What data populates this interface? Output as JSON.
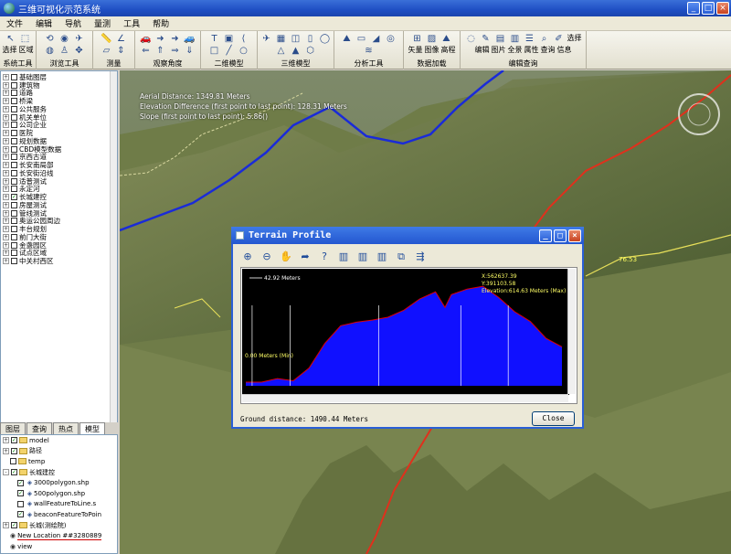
{
  "window": {
    "title": "三维可视化示范系统",
    "min": "_",
    "max": "□",
    "close": "×"
  },
  "menu": [
    "文件",
    "编辑",
    "导航",
    "量测",
    "工具",
    "帮助"
  ],
  "toolbar": {
    "groups": [
      {
        "label": "系统工具",
        "items": [
          "选择",
          "区域"
        ]
      },
      {
        "label": "浏览工具",
        "items": []
      },
      {
        "label": "测量",
        "items": []
      },
      {
        "label": "观察角度",
        "items": []
      },
      {
        "label": "二维模型",
        "items": []
      },
      {
        "label": "三维模型",
        "items": []
      },
      {
        "label": "分析工具",
        "items": []
      },
      {
        "label": "数据加载",
        "items": [
          "矢量",
          "图像",
          "高程"
        ]
      },
      {
        "label": "编辑查询",
        "items": [
          "选择",
          "编辑",
          "图片",
          "全景",
          "属性",
          "查询",
          "信息"
        ]
      }
    ]
  },
  "tree": [
    "基础图层",
    "建筑物",
    "道路",
    "桥梁",
    "公共服务",
    "机关单位",
    "公司企业",
    "医院",
    "规划数据",
    "CBD模型数据",
    "京西古道",
    "长安南局部",
    "长安街沿线",
    "适普测试",
    "永定河",
    "长城建控",
    "房屋测试",
    "管线测试",
    "奥运公园周边",
    "丰台规划",
    "前门大街",
    "金盏园区",
    "试点区域",
    "中关村西区"
  ],
  "tree_checked": [
    15
  ],
  "tabs": [
    "图层",
    "查询",
    "热点",
    "模型"
  ],
  "layers": [
    {
      "name": "model",
      "indent": 0,
      "exp": "+",
      "chk": true,
      "folder": true
    },
    {
      "name": "路径",
      "indent": 0,
      "exp": "+",
      "chk": true,
      "folder": true
    },
    {
      "name": "temp",
      "indent": 1,
      "exp": "",
      "chk": false,
      "folder": true
    },
    {
      "name": "长城建控",
      "indent": 0,
      "exp": "-",
      "chk": true,
      "folder": true
    },
    {
      "name": "3000polygon.shp",
      "indent": 2,
      "exp": "",
      "chk": true,
      "folder": false
    },
    {
      "name": "500polygon.shp",
      "indent": 2,
      "exp": "",
      "chk": true,
      "folder": false
    },
    {
      "name": "wallFeatureToLine.s",
      "indent": 2,
      "exp": "",
      "chk": false,
      "folder": false
    },
    {
      "name": "beaconFeatureToPoin",
      "indent": 2,
      "exp": "",
      "chk": true,
      "folder": false
    },
    {
      "name": "长城(测绘院)",
      "indent": 0,
      "exp": "+",
      "chk": true,
      "folder": true
    },
    {
      "name": "New Location ##3280889",
      "indent": 1,
      "exp": "",
      "chk": false,
      "folder": false,
      "eye": true
    },
    {
      "name": "view",
      "indent": 1,
      "exp": "",
      "chk": false,
      "folder": false,
      "eye": true
    }
  ],
  "overlay": {
    "line1": "Aerial Distance:    1349.81 Meters",
    "line2": "Elevation Difference (first point to last point): 128.31 Meters",
    "line3": "Slope (first point to last point):   5.86()"
  },
  "map_label": "76.53",
  "dialog": {
    "title": "Terrain Profile",
    "ground": "Ground distance: 1490.44 Meters",
    "close": "Close",
    "scale": "42.92 Meters",
    "min": "0.00 Meters (Min)",
    "x": "X:562637.39",
    "y": "Y:391103.58",
    "max": "Elevation:614.63 Meters (Max)"
  },
  "chart_data": {
    "type": "area",
    "title": "Terrain Profile",
    "xlabel": "",
    "ylabel": "",
    "x": [
      0,
      0.05,
      0.1,
      0.15,
      0.2,
      0.25,
      0.3,
      0.35,
      0.4,
      0.45,
      0.5,
      0.55,
      0.6,
      0.63,
      0.65,
      0.7,
      0.75,
      0.8,
      0.85,
      0.9,
      0.95,
      1.0
    ],
    "y": [
      0,
      0,
      5,
      2,
      20,
      55,
      80,
      85,
      88,
      92,
      102,
      118,
      128,
      106,
      124,
      132,
      136,
      120,
      100,
      86,
      62,
      50
    ],
    "color": "#1010ff",
    "line_color": "#e00000"
  }
}
